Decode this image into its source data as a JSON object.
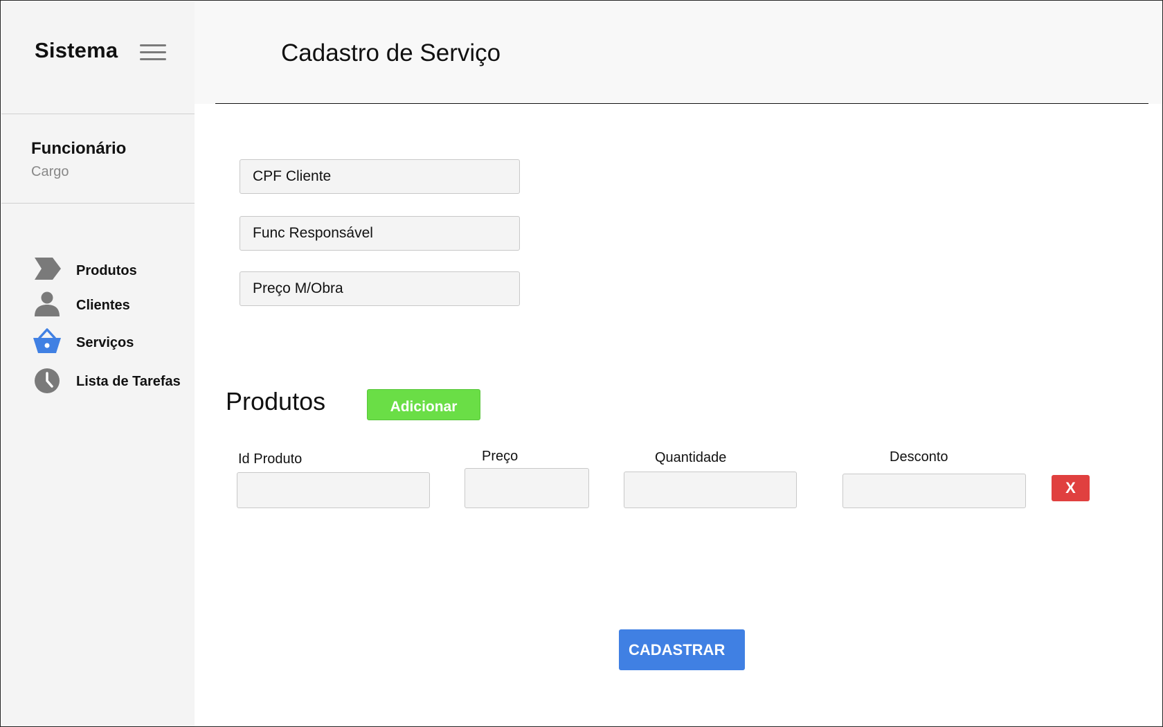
{
  "sidebar": {
    "brand": "Sistema",
    "user": {
      "name": "Funcionário",
      "role": "Cargo"
    },
    "nav": [
      {
        "label": "Produtos",
        "icon": "chevron-tag-icon",
        "color": "#7a7a7a"
      },
      {
        "label": "Clientes",
        "icon": "person-icon",
        "color": "#7a7a7a"
      },
      {
        "label": "Serviços",
        "icon": "basket-icon",
        "color": "#4080e3"
      },
      {
        "label": "Lista de Tarefas",
        "icon": "clock-icon",
        "color": "#7a7a7a"
      }
    ]
  },
  "header": {
    "title": "Cadastro de Serviço"
  },
  "form": {
    "cpf_placeholder": "CPF Cliente",
    "func_placeholder": "Func Responsável",
    "preco_mobra_placeholder": "Preço M/Obra"
  },
  "products": {
    "title": "Produtos",
    "add_label": "Adicionar",
    "columns": {
      "id": "Id Produto",
      "price": "Preço",
      "quantity": "Quantidade",
      "discount": "Desconto"
    },
    "remove_label": "X"
  },
  "submit_label": "CADASTRAR",
  "colors": {
    "accent": "#4080e3",
    "add": "#6ade46",
    "remove": "#e0403f"
  }
}
